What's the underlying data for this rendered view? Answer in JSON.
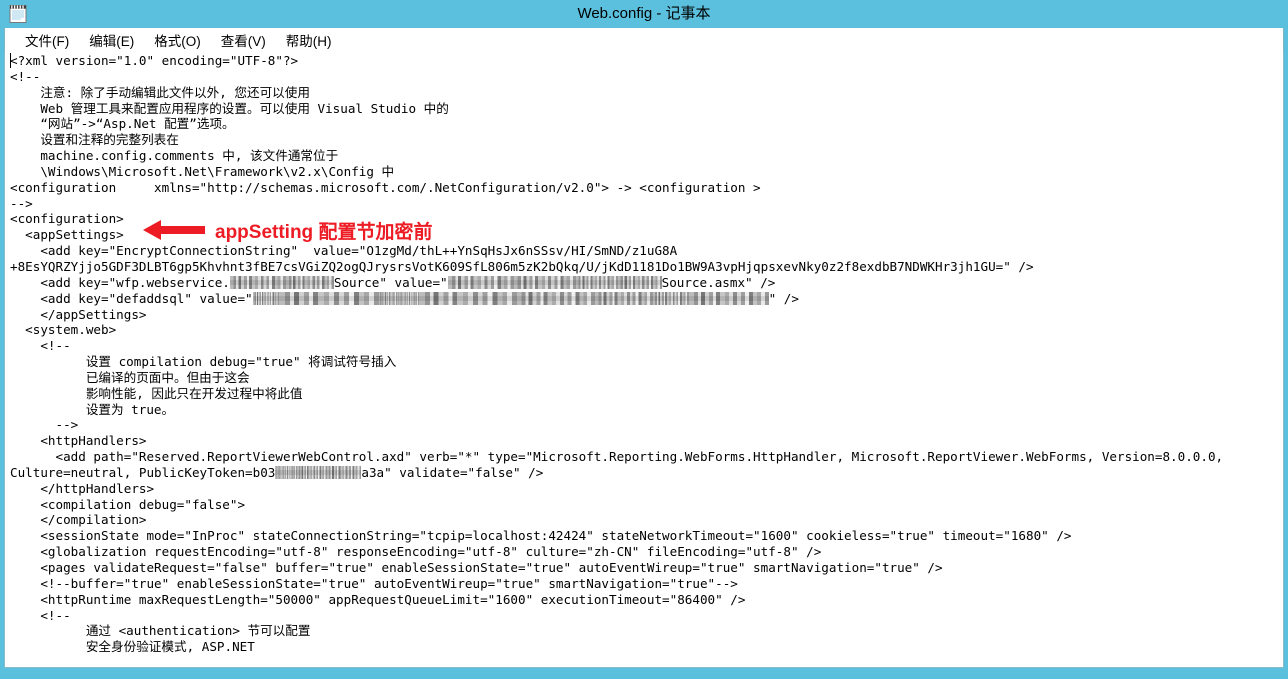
{
  "window": {
    "title": "Web.config - 记事本",
    "icon": "notepad-icon",
    "accent_color": "#5bc0de",
    "background_color": "#ffffff"
  },
  "menubar": {
    "items": [
      {
        "label": "文件(F)",
        "name": "menu-file"
      },
      {
        "label": "编辑(E)",
        "name": "menu-edit"
      },
      {
        "label": "格式(O)",
        "name": "menu-format"
      },
      {
        "label": "查看(V)",
        "name": "menu-view"
      },
      {
        "label": "帮助(H)",
        "name": "menu-help"
      }
    ]
  },
  "annotation": {
    "text": "appSetting 配置节加密前",
    "color": "#ed1c24",
    "arrow": "arrow-left-icon"
  },
  "editor": {
    "lines": [
      "<?xml version=\"1.0\" encoding=\"UTF-8\"?>",
      "<!--",
      "    注意: 除了手动编辑此文件以外, 您还可以使用",
      "    Web 管理工具来配置应用程序的设置。可以使用 Visual Studio 中的",
      "    “网站”->“Asp.Net 配置”选项。",
      "    设置和注释的完整列表在",
      "    machine.config.comments 中, 该文件通常位于",
      "    \\Windows\\Microsoft.Net\\Framework\\v2.x\\Config 中",
      "<configuration     xmlns=\"http://schemas.microsoft.com/.NetConfiguration/v2.0\"> -> <configuration >",
      "-->",
      "<configuration>",
      "  <appSettings>",
      "    <add key=\"EncryptConnectionString\"  value=\"O1zgMd/thL++YnSqHsJx6nSSsv/HI/SmND/z1uG8A",
      "+8EsYQRZYjjo5GDF3DLBT6gp5Khvhnt3fBE7csVGiZQ2ogQJrysrsVotK609SfL806m5zK2bQkq/U/jKdD1181Do1BW9A3vpHjqpsxevNky0z2f8exdbB7NDWKHr3jh1GU=\" />",
      "    </appSettings>",
      "  <system.web>",
      "    <!--",
      "          设置 compilation debug=\"true\" 将调试符号插入",
      "          已编译的页面中。但由于这会",
      "          影响性能, 因此只在开发过程中将此值",
      "          设置为 true。",
      "      -->",
      "    <httpHandlers>",
      "      <add path=\"Reserved.ReportViewerWebControl.axd\" verb=\"*\" type=\"Microsoft.Reporting.WebForms.HttpHandler, Microsoft.ReportViewer.WebForms, Version=8.0.0.0,",
      "    </httpHandlers>",
      "    <compilation debug=\"false\">",
      "    </compilation>",
      "    <sessionState mode=\"InProc\" stateConnectionString=\"tcpip=localhost:42424\" stateNetworkTimeout=\"1600\" cookieless=\"true\" timeout=\"1680\" />",
      "    <globalization requestEncoding=\"utf-8\" responseEncoding=\"utf-8\" culture=\"zh-CN\" fileEncoding=\"utf-8\" />",
      "    <pages validateRequest=\"false\" buffer=\"true\" enableSessionState=\"true\" autoEventWireup=\"true\" smartNavigation=\"true\" />",
      "    <!--buffer=\"true\" enableSessionState=\"true\" autoEventWireup=\"true\" smartNavigation=\"true\"-->",
      "    <httpRuntime maxRequestLength=\"50000\" appRequestQueueLimit=\"1600\" executionTimeout=\"86400\" />",
      "    <!--",
      "          通过 <authentication> 节可以配置",
      "          安全身份验证模式, ASP.NET"
    ],
    "redacted_lines": {
      "wfp_webservice_prefix": "    <add key=\"wfp.webservice.",
      "wfp_webservice_mid": "Source\" value=\"",
      "wfp_webservice_suffix": "Source.asmx\" />",
      "defaddsql_prefix": "    <add key=\"defaddsql\" value=\"",
      "defaddsql_suffix": "\" />",
      "culture_prefix": "Culture=neutral, PublicKeyToken=b03",
      "culture_suffix": "a3a\" validate=\"false\" />"
    }
  }
}
